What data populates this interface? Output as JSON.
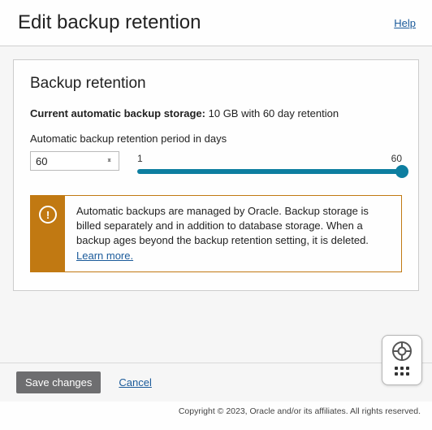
{
  "header": {
    "title": "Edit backup retention",
    "help": "Help"
  },
  "panel": {
    "title": "Backup retention",
    "storage_label": "Current automatic backup storage:",
    "storage_value": "10 GB with 60 day retention",
    "slider_label": "Automatic backup retention period in days",
    "value": "60",
    "min": "1",
    "max": "60"
  },
  "notice": {
    "text": "Automatic backups are managed by Oracle. Backup storage is billed separately and in addition to database storage. When a backup ages beyond the backup retention setting, it is deleted.",
    "learn_more": "Learn more."
  },
  "footer": {
    "save": "Save changes",
    "cancel": "Cancel"
  },
  "copyright": "Copyright © 2023, Oracle and/or its affiliates. All rights reserved."
}
